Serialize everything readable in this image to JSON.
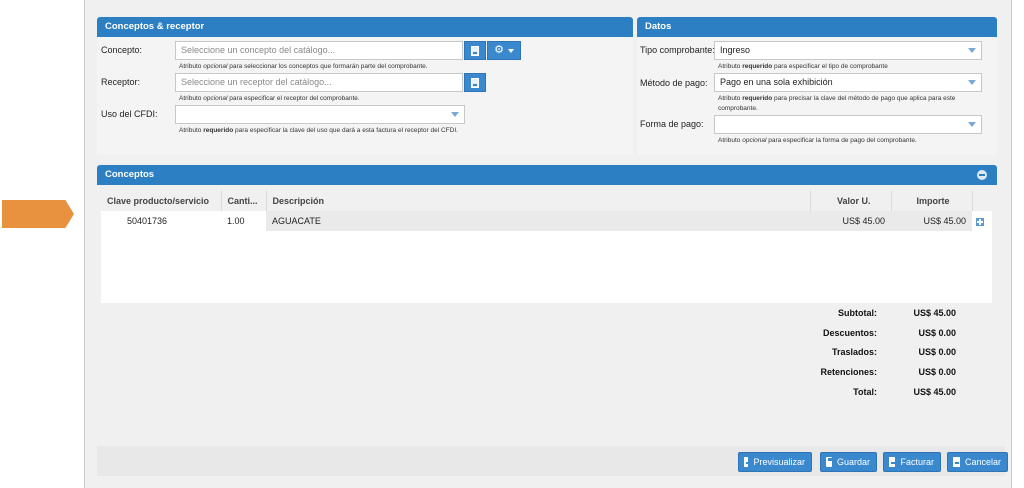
{
  "conceptos_receptor": {
    "title": "Conceptos & receptor",
    "concepto": {
      "label": "Concepto:",
      "placeholder": "Seleccione un concepto del catálogo...",
      "hint_pre": "Atributo ",
      "hint_em": "opcional",
      "hint_post": " para seleccionar los conceptos que formarán parte del comprobante."
    },
    "receptor": {
      "label": "Receptor:",
      "placeholder": "Seleccione un receptor del catálogo...",
      "hint_pre": "Atributo ",
      "hint_em": "opcional",
      "hint_post": " para especificar el receptor del comprobante."
    },
    "uso_cfdi": {
      "label": "Uso del CFDI:",
      "value": "",
      "hint_pre": "Atributo ",
      "hint_strong": "requerido",
      "hint_post": " para especificar la clave del uso que dará a esta factura el receptor del CFDI."
    }
  },
  "datos": {
    "title": "Datos",
    "tipo_comprobante": {
      "label": "Tipo comprobante:",
      "value": "Ingreso",
      "hint_pre": "Atributo ",
      "hint_strong": "requerido",
      "hint_post": " para especificar el tipo de comprobante"
    },
    "metodo_pago": {
      "label": "Método de pago:",
      "value": "Pago en una sola exhibición",
      "hint_pre": "Atributo ",
      "hint_strong": "requerido",
      "hint_post": " para precisar la clave del método de pago que aplica para este",
      "hint_line2": "comprobante."
    },
    "forma_pago": {
      "label": "Forma de pago:",
      "value": "",
      "hint_pre": "Atributo ",
      "hint_em": "opcional",
      "hint_post": " para especificar la forma de pago del comprobante."
    }
  },
  "conceptos": {
    "title": "Conceptos",
    "columns": [
      "Clave producto/servicio",
      "Canti...",
      "Descripción",
      "Valor U.",
      "Importe"
    ],
    "rows": [
      {
        "clave": "50401736",
        "cantidad": "1.00",
        "descripcion": "AGUACATE",
        "valor": "US$ 45.00",
        "importe": "US$ 45.00"
      }
    ],
    "totals": [
      {
        "label": "Subtotal:",
        "value": "US$ 45.00"
      },
      {
        "label": "Descuentos:",
        "value": "US$ 0.00"
      },
      {
        "label": "Traslados:",
        "value": "US$ 0.00"
      },
      {
        "label": "Retenciones:",
        "value": "US$ 0.00"
      },
      {
        "label": "Total:",
        "value": "US$ 45.00"
      }
    ]
  },
  "footer": {
    "previsualizar": "Previsualizar",
    "guardar": "Guardar",
    "facturar": "Facturar",
    "cancelar": "Cancelar"
  },
  "colors": {
    "header_blue": "#2d7fc3",
    "arrow_orange": "#e8923f"
  }
}
